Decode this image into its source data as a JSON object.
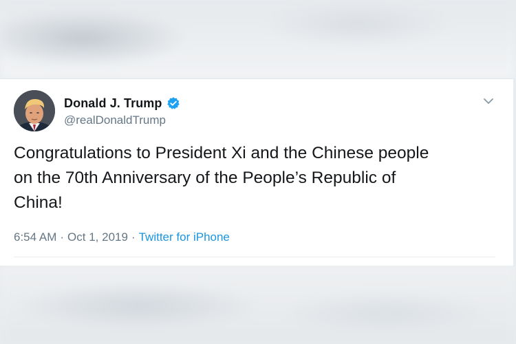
{
  "tweet": {
    "author": {
      "display_name": "Donald J. Trump",
      "handle": "@realDonaldTrump",
      "verified_icon": "verified-badge-icon",
      "avatar_icon": "profile-photo"
    },
    "text": "Congratulations to President Xi and the Chinese people\non the 70th Anniversary of the People’s Republic of\nChina!",
    "time": "6:54 AM",
    "date": "Oct 1, 2019",
    "separator": "·",
    "source": "Twitter for iPhone",
    "menu_icon": "chevron-down-icon"
  },
  "colors": {
    "text_primary": "#14171a",
    "text_secondary": "#657786",
    "link": "#1b95e0",
    "verified": "#1da1f2"
  }
}
